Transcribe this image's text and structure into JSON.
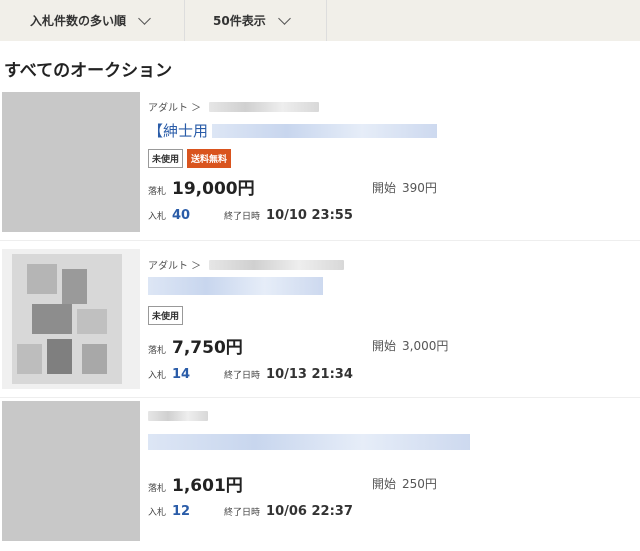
{
  "sort": {
    "label": "入札件数の多い順",
    "count_label": "50件表示"
  },
  "heading": "すべてのオークション",
  "items": [
    {
      "category": "アダルト ＞",
      "title": "【紳士用",
      "badges": [
        "未使用",
        "送料無料"
      ],
      "price_label": "落札",
      "price": "19,000円",
      "start_label": "開始",
      "start_price": "390円",
      "bids_label": "入札",
      "bids": "40",
      "end_label": "終了日時",
      "end": "10/10 23:55"
    },
    {
      "category": "アダルト ＞",
      "title": "",
      "badges": [
        "未使用"
      ],
      "price_label": "落札",
      "price": "7,750円",
      "start_label": "開始",
      "start_price": "3,000円",
      "bids_label": "入札",
      "bids": "14",
      "end_label": "終了日時",
      "end": "10/13 21:34"
    },
    {
      "category": "",
      "title": "",
      "badges": [],
      "price_label": "落札",
      "price": "1,601円",
      "start_label": "開始",
      "start_price": "250円",
      "bids_label": "入札",
      "bids": "12",
      "end_label": "終了日時",
      "end": "10/06 22:37"
    }
  ]
}
